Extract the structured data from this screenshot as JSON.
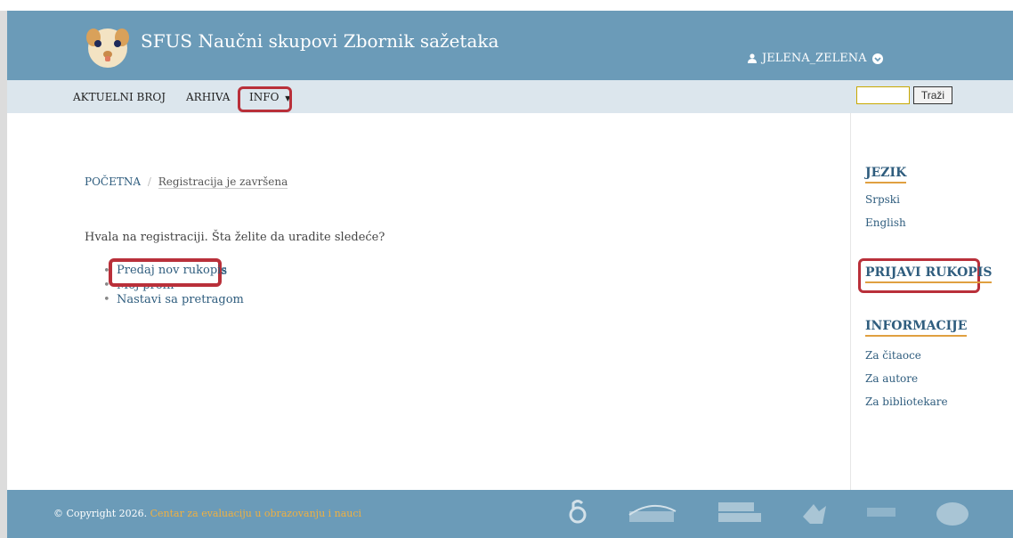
{
  "header": {
    "site_title": "SFUS Naučni skupovi Zbornik sažetaka",
    "user": {
      "icon": "user-icon",
      "name": "JELENA_ZELENA",
      "dropdown_icon": "chevron-down-circle-icon"
    }
  },
  "nav": {
    "items": [
      {
        "label": "AKTUELNI BROJ"
      },
      {
        "label": "ARHIVA"
      },
      {
        "label": "INFO",
        "has_dropdown": true
      }
    ],
    "search": {
      "button_label": "Traži",
      "value": ""
    }
  },
  "breadcrumb": {
    "home": "POČETNA",
    "separator": "/",
    "current": "Registracija je završena"
  },
  "main": {
    "message": "Hvala na registraciji. Šta želite da uradite sledeće?",
    "actions": [
      {
        "label": "Predaj nov rukopis"
      },
      {
        "label": "Moj profil"
      },
      {
        "label": "Nastavi sa pretragom"
      }
    ]
  },
  "sidebar": {
    "language_heading": "JEZIK",
    "languages": [
      "Srpski",
      "English"
    ],
    "submit_heading": "PRIJAVI RUKOPIS",
    "info_heading": "INFORMACIJE",
    "info_links": [
      "Za čitaoce",
      "Za autore",
      "Za bibliotekare"
    ]
  },
  "footer": {
    "copyright": "© Copyright 2026.",
    "organization": "Centar za evaluaciju u obrazovanju i nauci",
    "logos": [
      "open-access-logo",
      "crossref-logo",
      "crosscheck-logo",
      "bird-logo",
      "cope-logo",
      "circle-logo"
    ]
  },
  "colors": {
    "header_bg": "#6b9bb8",
    "nav_bg": "#dce6ed",
    "link": "#2f5d7e",
    "highlight": "#b9303a",
    "accent_underline": "#e0a040"
  }
}
